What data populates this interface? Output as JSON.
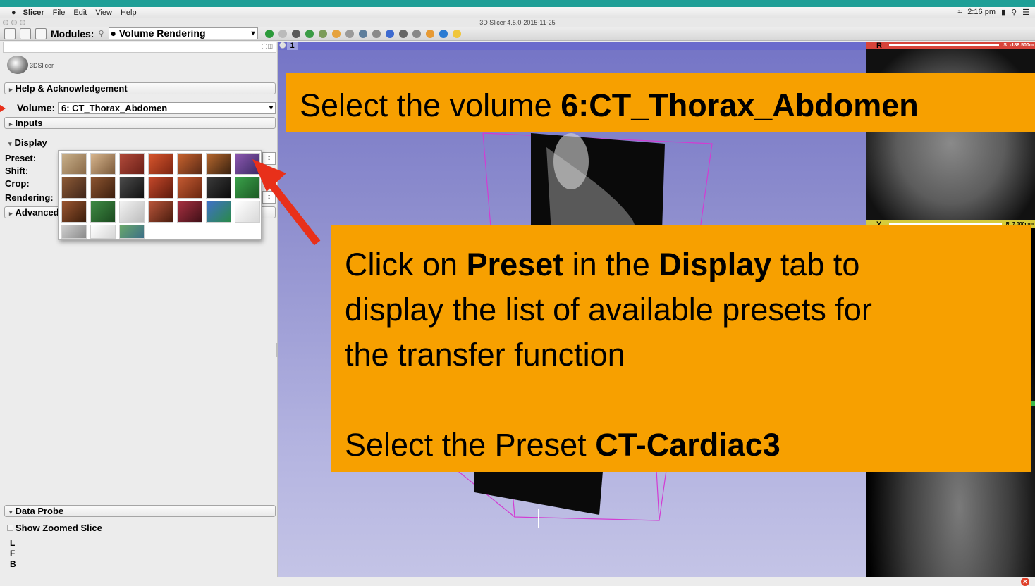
{
  "menubar": {
    "apple_icon": "apple-icon",
    "app_name": "Slicer",
    "items": [
      "File",
      "Edit",
      "View",
      "Help"
    ],
    "clock": "2:16 pm"
  },
  "window": {
    "title": "3D Slicer 4.5.0-2015-11-25"
  },
  "toolbar": {
    "modules_label": "Modules:",
    "module_selected": "Volume Rendering"
  },
  "panel": {
    "logo_text": "3DSlicer",
    "help_label": "Help & Acknowledgement",
    "volume_label": "Volume:",
    "volume_value": "6: CT_Thorax_Abdomen",
    "inputs_label": "Inputs",
    "display_label": "Display",
    "preset_label": "Preset:",
    "shift_label": "Shift:",
    "crop_label": "Crop:",
    "rendering_label": "Rendering:",
    "advanced_label": "Advanced",
    "data_probe_label": "Data Probe",
    "show_zoomed_label": "Show Zoomed Slice",
    "coord_l": "L",
    "coord_f": "F",
    "coord_b": "B"
  },
  "view3d": {
    "number": "1"
  },
  "slices": {
    "red": {
      "label": "R",
      "value": "S: -188.500m"
    },
    "yellow": {
      "label": "Y",
      "value": "R: 7.000mm"
    }
  },
  "callout1": {
    "text": "Select the volume ",
    "bold": "6:CT_Thorax_Abdomen"
  },
  "callout2": {
    "l1a": "Click on ",
    "l1b": "Preset",
    "l1c": " in the ",
    "l1d": "Display",
    "l1e": " tab to",
    "l2": "display the list of available presets for",
    "l3": "the transfer function",
    "l4a": "Select the Preset ",
    "l4b": "CT-Cardiac3"
  },
  "colors": {
    "callout_bg": "#f7a000",
    "arrow": "#e8301a",
    "view3d_top": "#7474c6",
    "view3d_bottom": "#c4c4e6"
  }
}
